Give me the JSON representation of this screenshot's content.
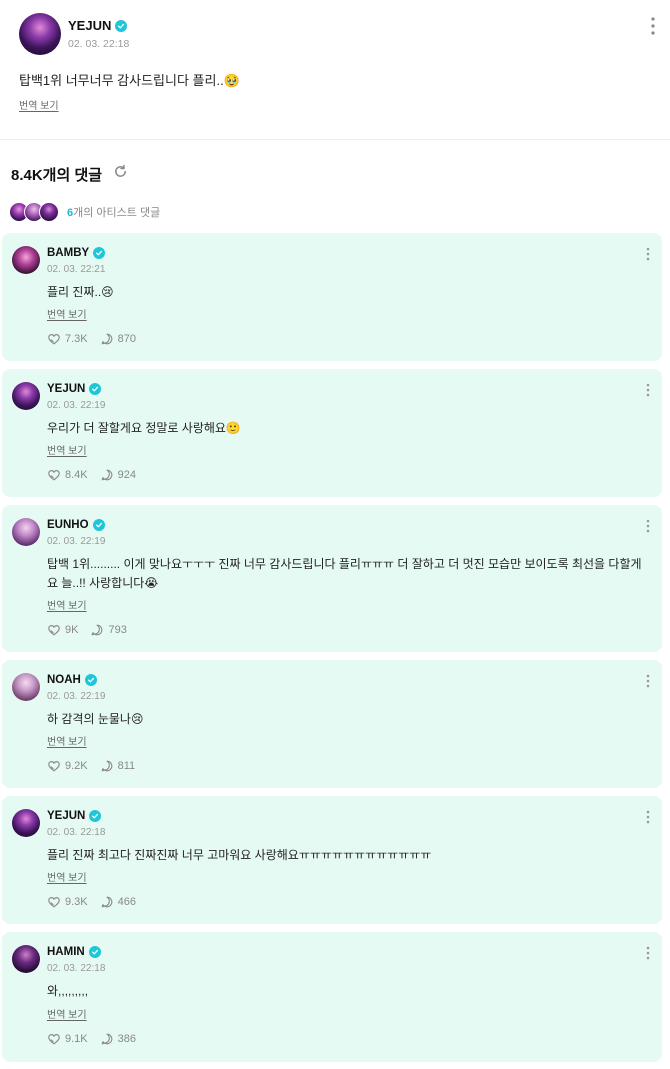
{
  "post": {
    "author": "YEJUN",
    "time": "02. 03. 22:18",
    "text": "탑백1위 너무너무 감사드립니다 플리..🥹",
    "translate_label": "번역 보기"
  },
  "comments_header": {
    "title": "8.4K개의 댓글",
    "artist_count": "6",
    "artist_label": "개의 아티스트 댓글"
  },
  "comments": [
    {
      "author": "BAMBY",
      "time": "02. 03. 22:21",
      "text": "플리 진짜..😢",
      "translate_label": "번역 보기",
      "likes": "7.3K",
      "replies": "870"
    },
    {
      "author": "YEJUN",
      "time": "02. 03. 22:19",
      "text": "우리가 더 잘할게요 정말로 사랑해요🙂",
      "translate_label": "번역 보기",
      "likes": "8.4K",
      "replies": "924"
    },
    {
      "author": "EUNHO",
      "time": "02. 03. 22:19",
      "text": "탑백 1위......... 이게 맞나요ㅜㅜㅜ 진짜 너무 감사드립니다 플리ㅠㅠㅠ 더 잘하고 더 멋진 모습만 보이도록 최선을 다할게요 늘..!! 사랑합니다😭",
      "translate_label": "번역 보기",
      "likes": "9K",
      "replies": "793"
    },
    {
      "author": "NOAH",
      "time": "02. 03. 22:19",
      "text": "하 감격의 눈물나😢",
      "translate_label": "번역 보기",
      "likes": "9.2K",
      "replies": "811"
    },
    {
      "author": "YEJUN",
      "time": "02. 03. 22:18",
      "text": "플리 진짜 최고다 진짜진짜 너무 고마워요 사랑해요ㅠㅠㅠㅠㅠㅠㅠㅠㅠㅠㅠㅠ",
      "translate_label": "번역 보기",
      "likes": "9.3K",
      "replies": "466"
    },
    {
      "author": "HAMIN",
      "time": "02. 03. 22:18",
      "text": "와,,,,,,,,,",
      "translate_label": "번역 보기",
      "likes": "9.1K",
      "replies": "386"
    }
  ],
  "icons": {
    "verified": "verified-badge-icon",
    "more": "more-vertical-icon",
    "refresh": "refresh-icon",
    "like": "heart-hand-icon",
    "reply": "chat-bubble-icon"
  },
  "colors": {
    "accent": "#1fc6d8",
    "card_background": "#e6faf4",
    "muted_text": "#999999"
  }
}
